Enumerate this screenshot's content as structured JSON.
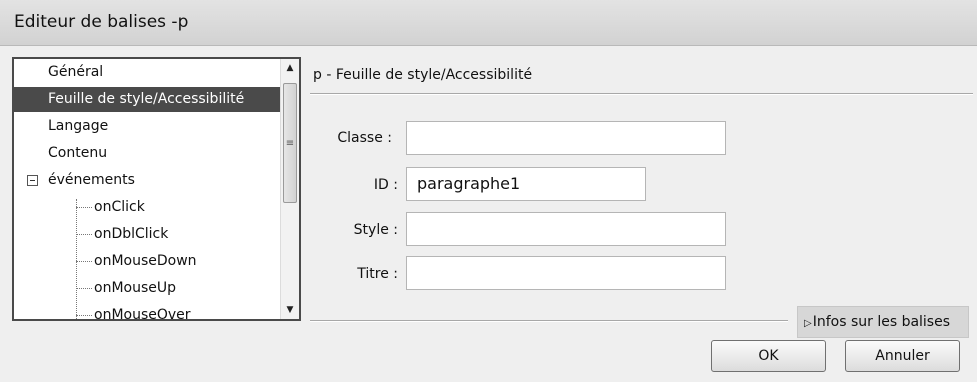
{
  "window": {
    "title": "Editeur de balises -p"
  },
  "tree": {
    "items": [
      {
        "label": "Général"
      },
      {
        "label": "Feuille de style/Accessibilité",
        "selected": true
      },
      {
        "label": "Langage"
      },
      {
        "label": "Contenu"
      },
      {
        "label": "événements",
        "expanded": true
      }
    ],
    "children": [
      {
        "label": "onClick"
      },
      {
        "label": "onDblClick"
      },
      {
        "label": "onMouseDown"
      },
      {
        "label": "onMouseUp"
      },
      {
        "label": "onMouseOver"
      }
    ],
    "scroll_up_icon": "triangle-up",
    "scroll_down_icon": "triangle-down"
  },
  "panel": {
    "title": "p - Feuille de style/Accessibilité",
    "fields": {
      "classe": {
        "label": "Classe :",
        "value": ""
      },
      "id": {
        "label": "ID :",
        "value": "paragraphe1"
      },
      "style": {
        "label": "Style :",
        "value": ""
      },
      "titre": {
        "label": "Titre :",
        "value": ""
      }
    }
  },
  "footer": {
    "infos_label": "Infos sur les balises",
    "ok_label": "OK",
    "cancel_label": "Annuler"
  },
  "colors": {
    "selection": "#4a4a4a",
    "title_bar": "#dcdcdc"
  }
}
